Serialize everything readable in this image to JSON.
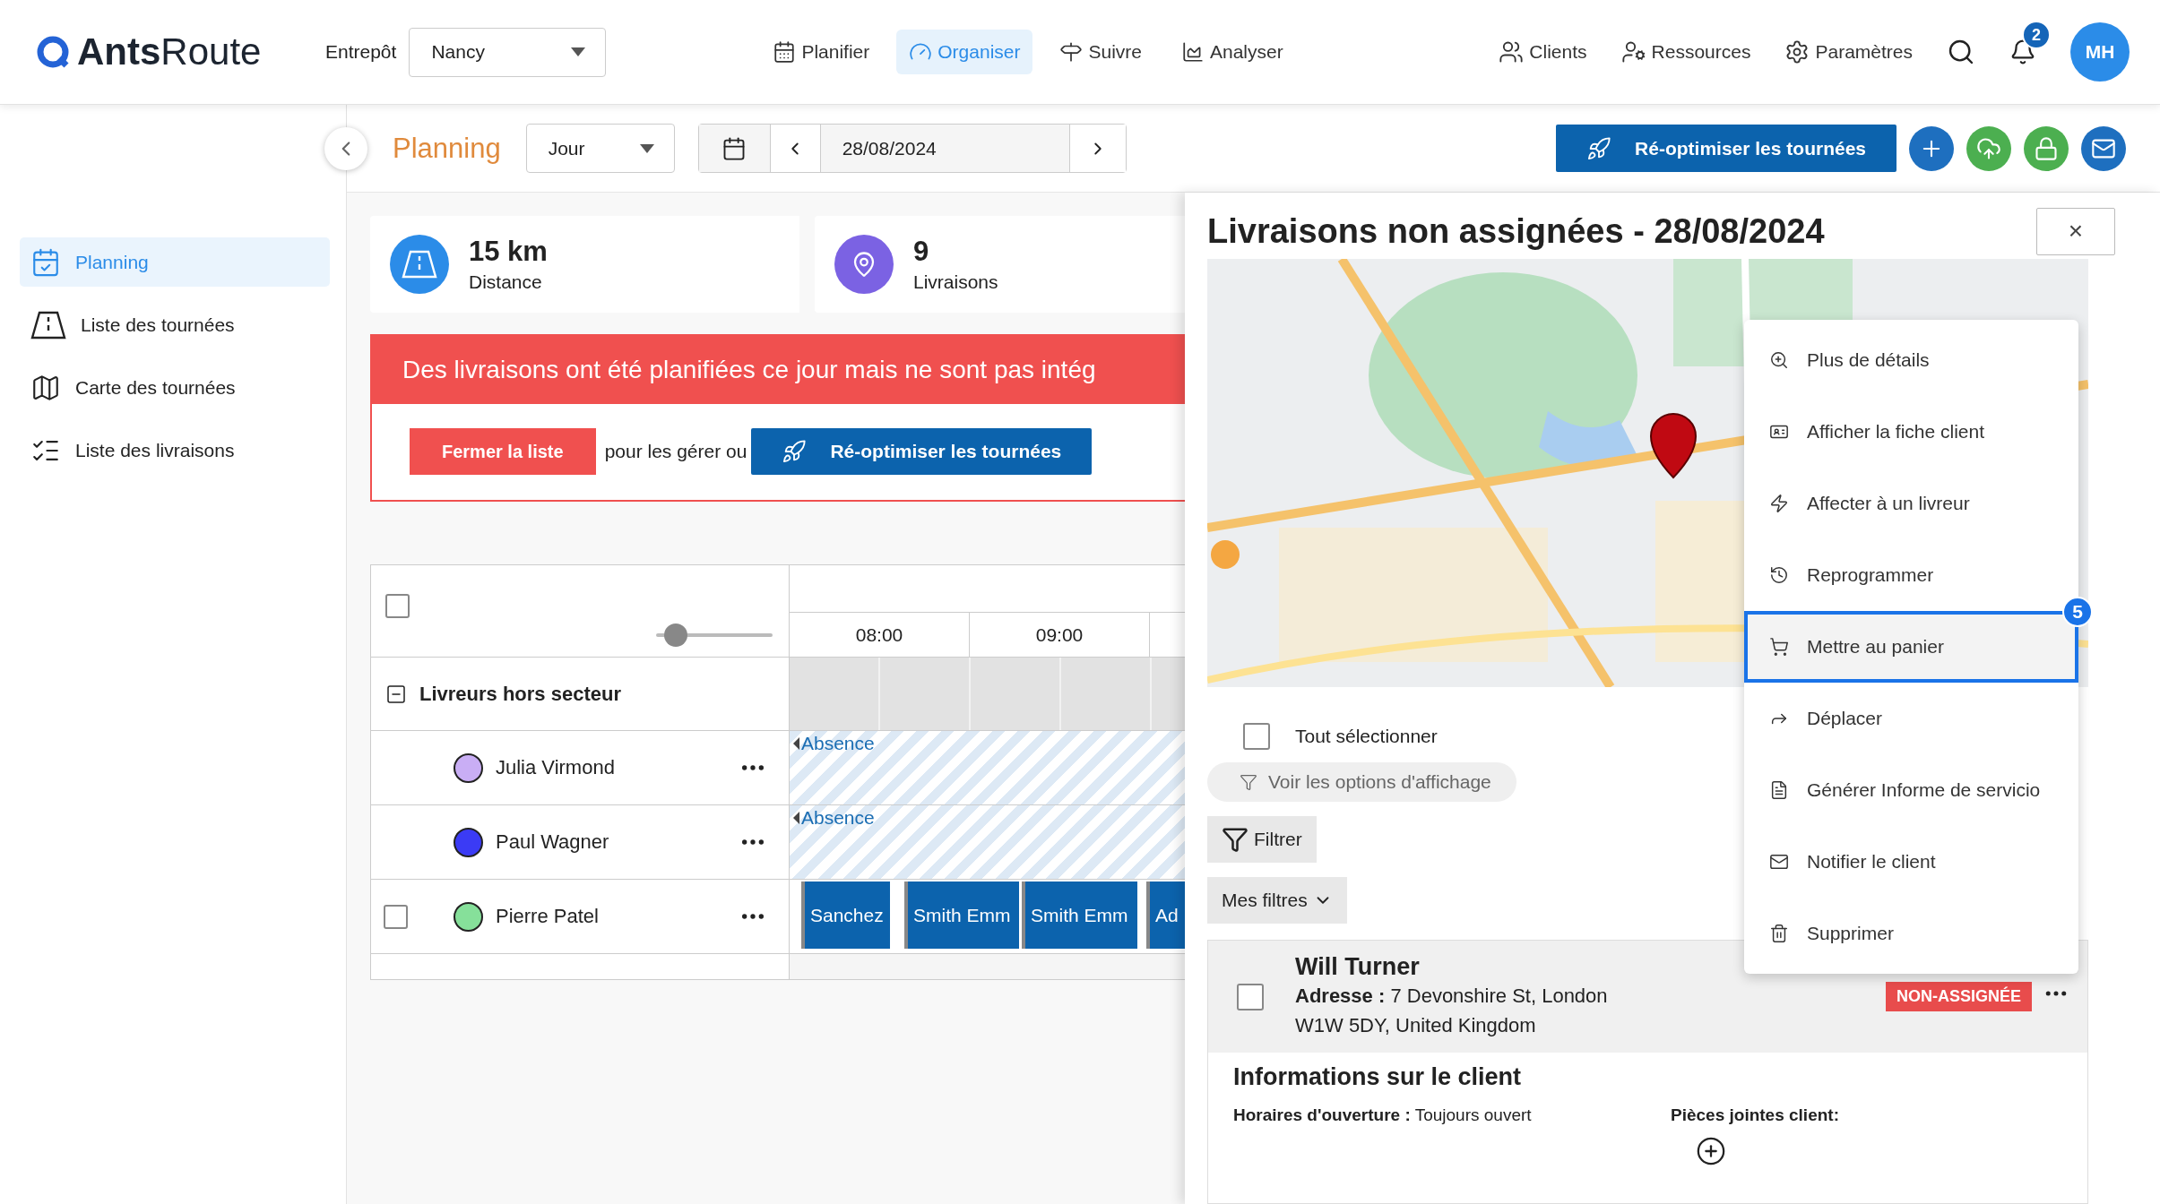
{
  "header": {
    "logo_bold": "Ants",
    "logo_light": "Route",
    "warehouse_label": "Entrepôt",
    "warehouse": "Nancy",
    "nav": [
      {
        "label": "Planifier",
        "selected": false
      },
      {
        "label": "Organiser",
        "selected": true
      },
      {
        "label": "Suivre",
        "selected": false
      },
      {
        "label": "Analyser",
        "selected": false
      }
    ],
    "right_nav": [
      "Clients",
      "Ressources",
      "Paramètres"
    ],
    "notifications": "2",
    "avatar": "MH"
  },
  "sidebar": {
    "items": [
      {
        "label": "Planning",
        "selected": true
      },
      {
        "label": "Liste des tournées",
        "selected": false
      },
      {
        "label": "Carte des tournées",
        "selected": false
      },
      {
        "label": "Liste des livraisons",
        "selected": false
      }
    ]
  },
  "toolbar": {
    "title": "Planning",
    "view": "Jour",
    "date": "28/08/2024",
    "reoptimize": "Ré-optimiser les tournées",
    "actions": [
      {
        "color": "#1e6fbf"
      },
      {
        "color": "#4caf50"
      },
      {
        "color": "#4caf50"
      },
      {
        "color": "#1e6fbf"
      }
    ]
  },
  "stats": [
    {
      "value": "15 km",
      "label": "Distance",
      "color": "#2b8ce8"
    },
    {
      "value": "9",
      "label": "Livraisons",
      "color": "#7b62e3"
    }
  ],
  "alert": {
    "message": "Des livraisons ont été planifiées ce jour mais ne sont pas intég",
    "close_button": "Fermer la liste",
    "middle": "pour les gérer ou",
    "reoptimize": "Ré-optimiser les tournées"
  },
  "schedule": {
    "select_all_checked": false,
    "zoom": {
      "level": 0.17
    },
    "hours": [
      "08:00",
      "09:00"
    ],
    "group": {
      "label": "Livreurs hors secteur",
      "expanded": true
    },
    "drivers": [
      {
        "name": "Julia Virmond",
        "color": "#c9aef5",
        "kind": "plain",
        "blocks": [
          {
            "kind": "absence",
            "label": "Absence"
          }
        ]
      },
      {
        "name": "Paul Wagner",
        "color": "#3b3bf5",
        "kind": "plain",
        "blocks": [
          {
            "kind": "absence",
            "label": "Absence"
          }
        ]
      },
      {
        "name": "Pierre Patel",
        "color": "#86e09a",
        "kind": "selectable",
        "checked": false,
        "blocks": [
          {
            "kind": "job",
            "label": "Sanchez"
          },
          {
            "kind": "job",
            "label": "Smith Emm"
          },
          {
            "kind": "job",
            "label": "Smith Emm"
          },
          {
            "kind": "job",
            "label": "Ad"
          }
        ]
      }
    ]
  },
  "panel": {
    "title": "Livraisons non assignées - 28/08/2024",
    "close": "×",
    "select_all": {
      "label": "Tout sélectionner",
      "checked": false
    },
    "display_options": "Voir les options d'affichage",
    "filter": "Filtrer",
    "my_filters": "Mes filtres",
    "delivery": {
      "name": "Will Turner",
      "checked": false,
      "address_label": "Adresse :",
      "address_lines": [
        "7 Devonshire St, London",
        "W1W 5DY, United Kingdom"
      ],
      "status": "NON-ASSIGNÉE"
    },
    "client_info": {
      "title": "Informations sur le client",
      "hours_label": "Horaires d'ouverture :",
      "hours": "Toujours ouvert",
      "attachments_label": "Pièces jointes client:"
    }
  },
  "context_menu": {
    "badge": "5",
    "items": [
      {
        "label": "Plus de détails",
        "selected": false
      },
      {
        "label": "Afficher la fiche client",
        "selected": false
      },
      {
        "label": "Affecter à un livreur",
        "selected": false
      },
      {
        "label": "Reprogrammer",
        "selected": false
      },
      {
        "label": "Mettre au panier",
        "selected": true
      },
      {
        "label": "Déplacer",
        "selected": false
      },
      {
        "label": "Générer Informe de servicio",
        "selected": false
      },
      {
        "label": "Notifier le client",
        "selected": false
      },
      {
        "label": "Supprimer",
        "selected": false
      }
    ]
  }
}
